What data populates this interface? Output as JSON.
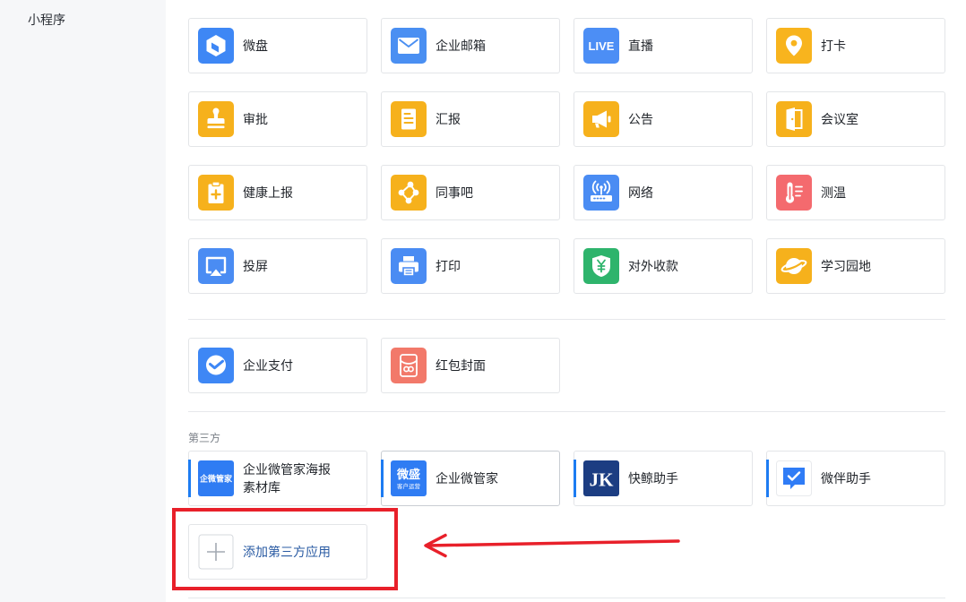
{
  "sidebar": {
    "items": [
      {
        "label": "小程序"
      }
    ]
  },
  "apps": [
    {
      "label": "微盘",
      "icon": "weipan-icon",
      "color": "#3e87f5"
    },
    {
      "label": "企业邮箱",
      "icon": "mail-icon",
      "color": "#4a8ff2"
    },
    {
      "label": "直播",
      "icon": "live-icon",
      "icon_text": "LIVE",
      "color": "#4c8ef5"
    },
    {
      "label": "打卡",
      "icon": "location-pin-icon",
      "color": "#f8b41e"
    },
    {
      "label": "审批",
      "icon": "stamp-icon",
      "color": "#f6b11c"
    },
    {
      "label": "汇报",
      "icon": "document-icon",
      "color": "#f6b11c"
    },
    {
      "label": "公告",
      "icon": "megaphone-icon",
      "color": "#f6b11c"
    },
    {
      "label": "会议室",
      "icon": "door-icon",
      "color": "#f6b11c"
    },
    {
      "label": "健康上报",
      "icon": "clipboard-plus-icon",
      "color": "#f6b11c"
    },
    {
      "label": "同事吧",
      "icon": "network-nodes-icon",
      "color": "#f6b11c"
    },
    {
      "label": "网络",
      "icon": "wifi-router-icon",
      "color": "#4a8cf3"
    },
    {
      "label": "测温",
      "icon": "thermometer-icon",
      "color": "#f46a6e"
    },
    {
      "label": "投屏",
      "icon": "screen-cast-icon",
      "color": "#4a8cf3"
    },
    {
      "label": "打印",
      "icon": "printer-icon",
      "color": "#4a8cf3"
    },
    {
      "label": "对外收款",
      "icon": "yuan-shield-icon",
      "color": "#2eb46c"
    },
    {
      "label": "学习园地",
      "icon": "planet-icon",
      "color": "#f6b11c"
    }
  ],
  "payment_apps": [
    {
      "label": "企业支付",
      "icon": "wechat-pay-icon",
      "color": "#3e87f5"
    },
    {
      "label": "红包封面",
      "icon": "red-packet-icon",
      "color": "#f2796a"
    }
  ],
  "third_party": {
    "section_label": "第三方",
    "apps": [
      {
        "label": "企业微管家海报素材库",
        "icon": "qiwei-guanjia-logo-icon",
        "icon_text": "企微管家",
        "color": "#2f7cf3"
      },
      {
        "label": "企业微管家",
        "icon": "weisheng-logo-icon",
        "icon_text": "微盛",
        "icon_subtext": "客户运营",
        "color": "#2f7cf3"
      },
      {
        "label": "快鲸助手",
        "icon": "kuaijing-logo-icon",
        "icon_text": "JK",
        "color": "#1c3d82"
      },
      {
        "label": "微伴助手",
        "icon": "weiban-chat-icon",
        "color": "#2f7cf6"
      }
    ],
    "add_button": {
      "label": "添加第三方应用",
      "icon": "plus-icon"
    }
  },
  "annotation": {
    "color": "#e8202a"
  }
}
